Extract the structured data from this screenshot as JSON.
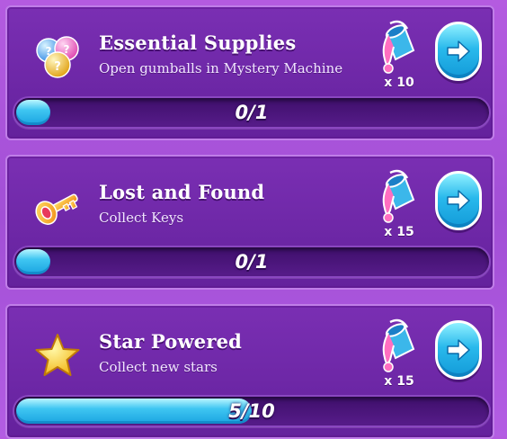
{
  "quests": [
    {
      "title": "Essential Supplies",
      "subtitle": "Open gumballs in Mystery Machine",
      "icon": "gumballs-icon",
      "reward_icon": "paint-bucket-icon",
      "reward_count": "x 10",
      "progress_text": "0/1",
      "progress_fraction": 0
    },
    {
      "title": "Lost and Found",
      "subtitle": "Collect Keys",
      "icon": "key-icon",
      "reward_icon": "paint-bucket-icon",
      "reward_count": "x 15",
      "progress_text": "0/1",
      "progress_fraction": 0
    },
    {
      "title": "Star Powered",
      "subtitle": "Collect new stars",
      "icon": "star-icon",
      "reward_icon": "paint-bucket-icon",
      "reward_count": "x 15",
      "progress_text": "5/10",
      "progress_fraction": 0.5
    }
  ],
  "colors": {
    "card": "#6d27a6",
    "background": "#a24fd6",
    "progress_fill": "#3fc6f2",
    "button": "#29b9ec"
  }
}
